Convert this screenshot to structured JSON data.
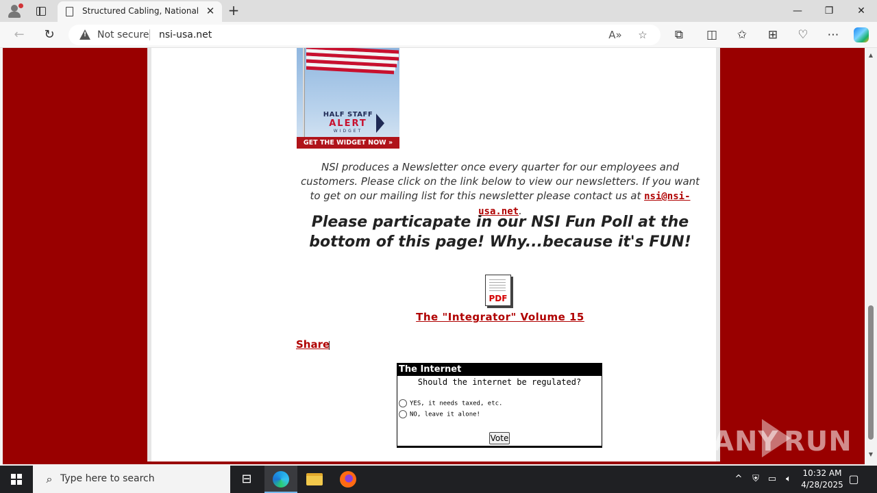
{
  "browser": {
    "tab_title": "Structured Cabling, National Syst",
    "tab_close": "✕",
    "new_tab": "+",
    "security_label": "Not secure",
    "url": "nsi-usa.net",
    "window_minimize": "—",
    "window_restore": "❐",
    "window_close": "✕"
  },
  "page": {
    "widget": {
      "line1": "HALF STAFF",
      "line2": "ALERT",
      "line3": "WIDGET",
      "cta": "GET THE WIDGET NOW »"
    },
    "newsletter": {
      "text_before": "NSI produces a Newsletter once every quarter for our employees and customers.  Please click on the link below to view our newsletters.  If you want to get on our mailing list for this newsletter please contact us at ",
      "email": "nsi@nsi-usa.net",
      "text_after": "."
    },
    "poll_invite": "Please particapate in our NSI Fun Poll at the bottom of this page!  Why...because it's FUN!",
    "pdf_label": "PDF",
    "pdf_link": "The \"Integrator\" Volume 15",
    "share_link": "Share",
    "poll": {
      "title": "The Internet",
      "question": "Should the internet be regulated?",
      "options": [
        "YES, it needs taxed, etc.",
        "NO, leave it alone!"
      ],
      "vote_label": "Vote"
    },
    "watermark": {
      "left": "ANY",
      "right": "RUN"
    }
  },
  "taskbar": {
    "search_placeholder": "Type here to search",
    "time": "10:32 AM",
    "date": "4/28/2025"
  },
  "colors": {
    "page_background": "#990000",
    "link_red": "#b00000",
    "poll_header": "#000000"
  }
}
